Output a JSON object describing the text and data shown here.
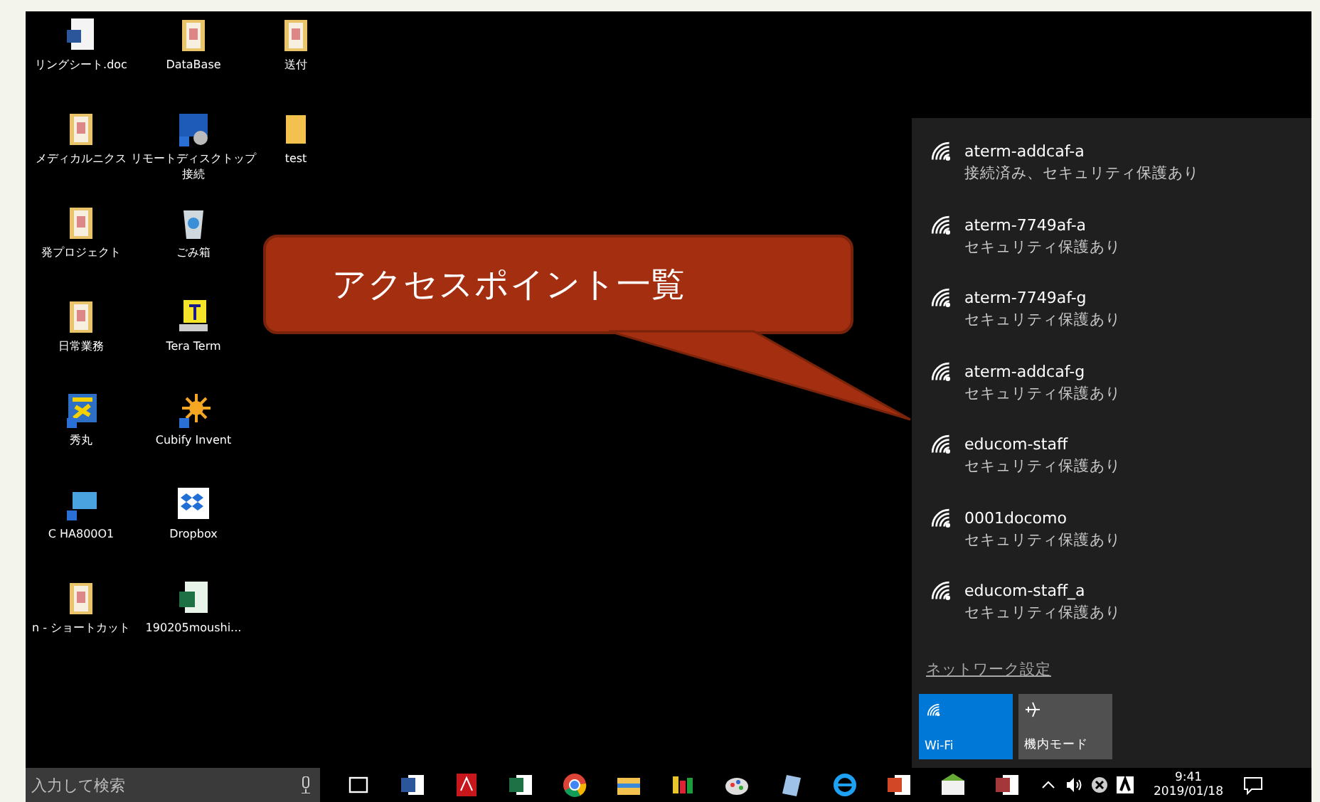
{
  "desktop": {
    "icons": [
      {
        "label": "リングシート.doc",
        "kind": "word"
      },
      {
        "label": "メディカルニクス",
        "kind": "folder"
      },
      {
        "label": "発プロジェクト",
        "kind": "folder"
      },
      {
        "label": "日常業務",
        "kind": "folder"
      },
      {
        "label": "秀丸",
        "kind": "hidemaru"
      },
      {
        "label": "C HA800O1",
        "kind": "pc"
      },
      {
        "label": "n - ショートカット",
        "kind": "folder"
      },
      {
        "label": "DataBase",
        "kind": "folder"
      },
      {
        "label": "リモートディスクトップ接続",
        "kind": "remote"
      },
      {
        "label": "ごみ箱",
        "kind": "recycle"
      },
      {
        "label": "Tera Term",
        "kind": "terminal"
      },
      {
        "label": "Cubify Invent",
        "kind": "sun"
      },
      {
        "label": "Dropbox",
        "kind": "boxes"
      },
      {
        "label": "190205moushi...",
        "kind": "excel"
      },
      {
        "label": "送付",
        "kind": "folder"
      },
      {
        "label": "test",
        "kind": "plainfolder"
      }
    ]
  },
  "callout": {
    "text": "アクセスポイント一覧"
  },
  "wifi_panel": {
    "networks": [
      {
        "name": "aterm-addcaf-a",
        "status": "接続済み、セキュリティ保護あり"
      },
      {
        "name": "aterm-7749af-a",
        "status": "セキュリティ保護あり"
      },
      {
        "name": "aterm-7749af-g",
        "status": "セキュリティ保護あり"
      },
      {
        "name": "aterm-addcaf-g",
        "status": "セキュリティ保護あり"
      },
      {
        "name": "educom-staff",
        "status": "セキュリティ保護あり"
      },
      {
        "name": "0001docomo",
        "status": "セキュリティ保護あり"
      },
      {
        "name": "educom-staff_a",
        "status": "セキュリティ保護あり"
      }
    ],
    "settings_link": "ネットワーク設定",
    "tiles": [
      {
        "label": "Wi-Fi",
        "kind": "wifi",
        "on": true
      },
      {
        "label": "機内モード",
        "kind": "airplane",
        "on": false
      }
    ]
  },
  "taskbar": {
    "search": {
      "placeholder": "入力して検索"
    },
    "apps": [
      {
        "kind": "taskview"
      },
      {
        "kind": "word"
      },
      {
        "kind": "pdf"
      },
      {
        "kind": "excel"
      },
      {
        "kind": "chrome"
      },
      {
        "kind": "folder"
      },
      {
        "kind": "ftp"
      },
      {
        "kind": "paint"
      },
      {
        "kind": "notebook"
      },
      {
        "kind": "ie"
      },
      {
        "kind": "ppt"
      },
      {
        "kind": "mail"
      },
      {
        "kind": "access"
      }
    ],
    "tray": [
      {
        "kind": "caret"
      },
      {
        "kind": "volume"
      },
      {
        "kind": "xcircle"
      },
      {
        "kind": "adobe"
      }
    ],
    "time": "9:41",
    "date": "2019/01/18"
  }
}
